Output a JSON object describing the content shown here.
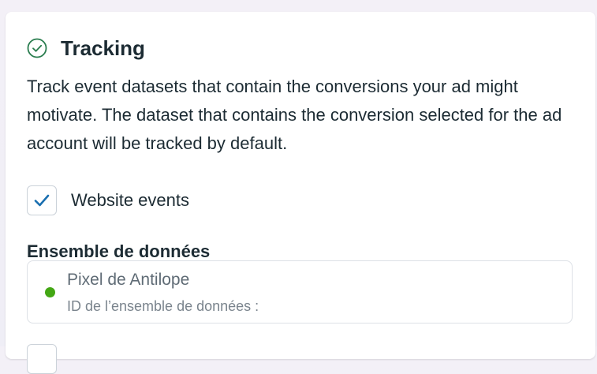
{
  "tracking": {
    "title": "Tracking",
    "status_icon": "check-circle-icon",
    "status_color": "#2a7d4f",
    "description": "Track event datasets that contain the conversions your ad might motivate. The dataset that contains the conversion selected for the ad account will be tracked by default."
  },
  "website_events": {
    "label": "Website events",
    "checked": true,
    "check_color": "#1a6fb0"
  },
  "dataset": {
    "heading": "Ensemble de données",
    "selected": {
      "name": "Pixel de Antilope",
      "id_label": "ID de l’ensemble de données :",
      "status_color": "#43a714"
    }
  }
}
